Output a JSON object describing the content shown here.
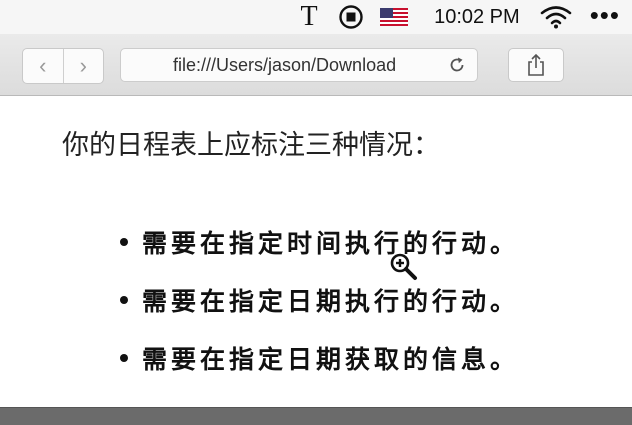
{
  "menubar": {
    "text_tool_glyph": "T",
    "stop_icon": "stop-record-icon",
    "flag_icon": "us-flag-icon",
    "clock": "10:02 PM",
    "wifi_icon": "wifi-icon",
    "more_glyph": "•••"
  },
  "browser": {
    "back_glyph": "‹",
    "forward_glyph": "›",
    "url": "file:///Users/jason/Download",
    "reload_icon": "reload-icon",
    "share_icon": "share-icon"
  },
  "page": {
    "heading": "你的日程表上应标注三种情况：",
    "bullets": [
      "需要在指定时间执行的行动。",
      "需要在指定日期执行的行动。",
      "需要在指定日期获取的信息。"
    ]
  },
  "cursor_icon": "zoom-in-cursor-icon",
  "colors": {
    "menubar_bg": "#f6f6f6",
    "toolbar_bg": "#e2e2e2",
    "page_bg": "#ffffff",
    "text": "#222222"
  }
}
